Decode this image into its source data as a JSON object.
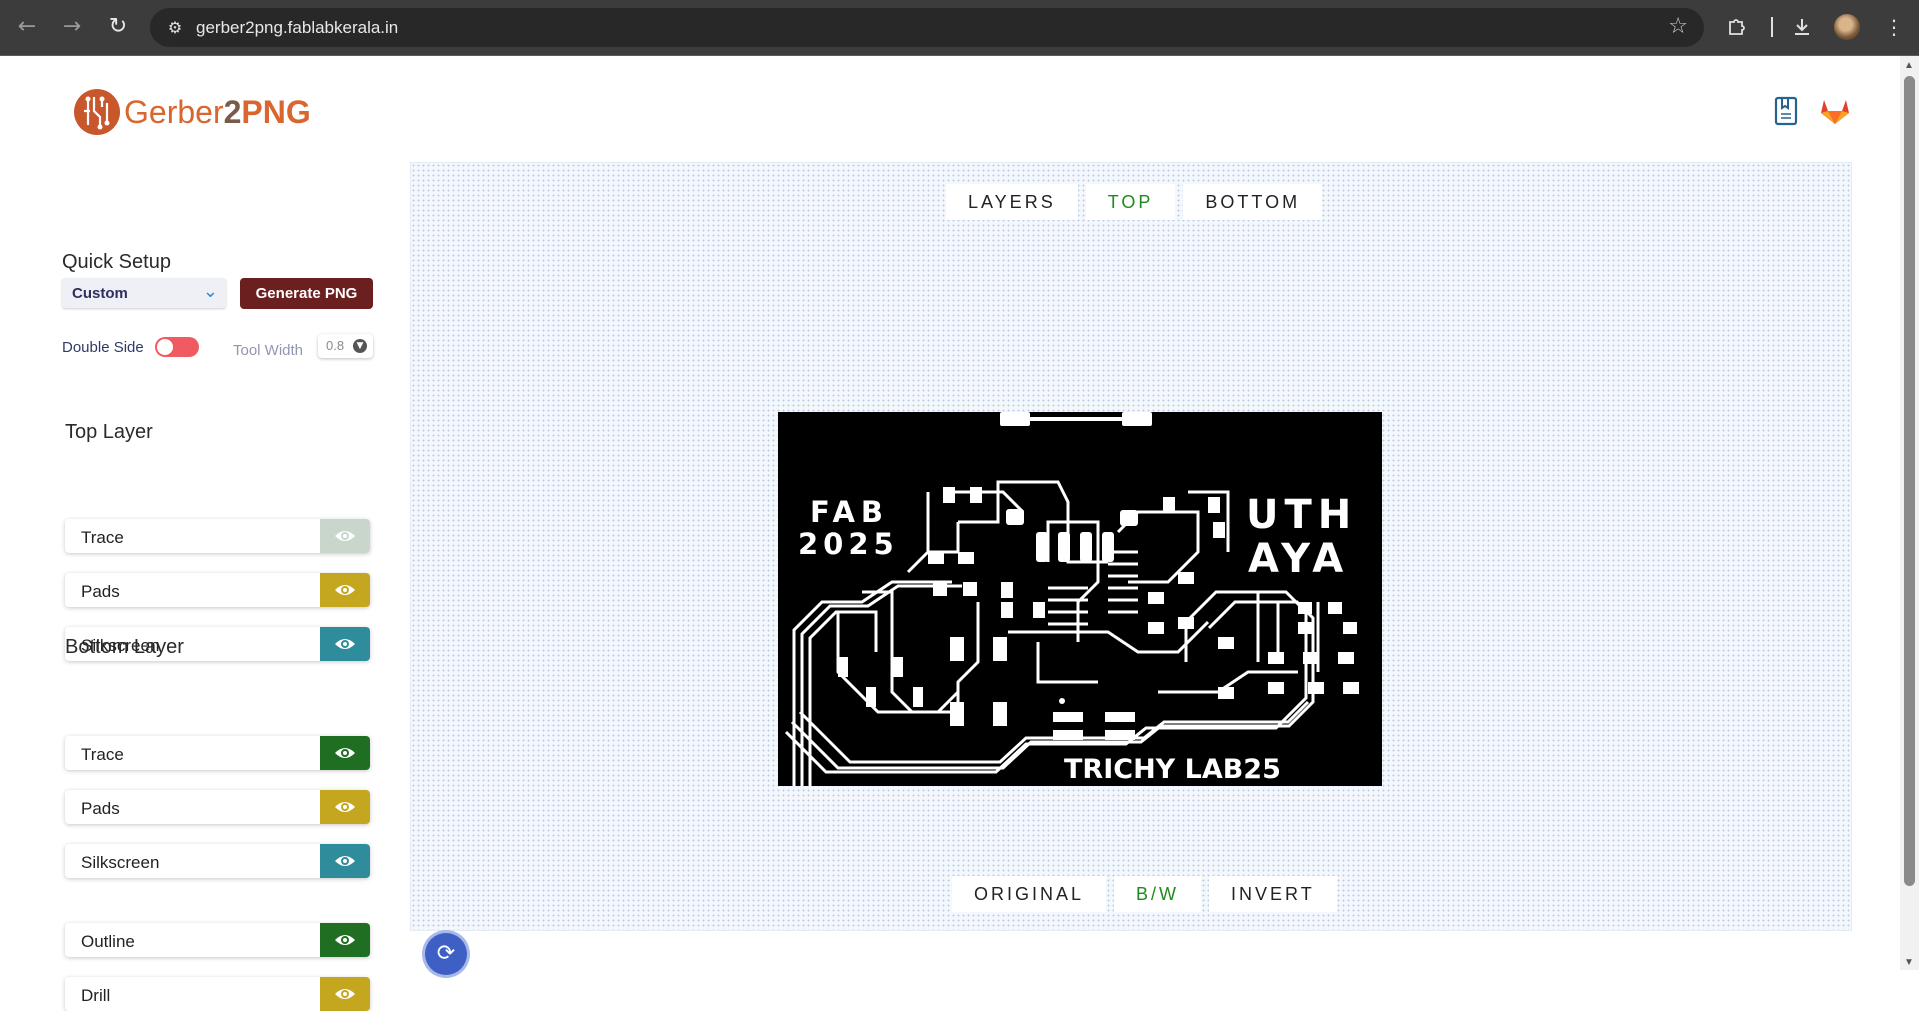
{
  "browser": {
    "url": "gerber2png.fablabkerala.in",
    "icons": [
      "back-arrow-icon",
      "forward-arrow-icon",
      "reload-icon",
      "site-settings-icon",
      "star-icon",
      "extensions-icon",
      "download-icon",
      "profile-avatar",
      "more-menu-icon"
    ]
  },
  "header": {
    "logo_prefix": "Gerber",
    "logo_two": "2",
    "logo_suffix": "PNG",
    "icons": [
      "docs-bookmark-icon",
      "gitlab-icon"
    ]
  },
  "sidebar": {
    "quick_setup_title": "Quick Setup",
    "preset_value": "Custom",
    "generate_label": "Generate PNG",
    "double_side_label": "Double Side",
    "double_side_on": false,
    "tool_width_label": "Tool Width",
    "tool_width_value": "0.8",
    "top_layer_title": "Top Layer",
    "top_layers": [
      {
        "label": "Trace",
        "color": "#c9d6cc",
        "visible": false
      },
      {
        "label": "Pads",
        "color": "#c4a71f",
        "visible": true
      },
      {
        "label": "Silkscreen",
        "color": "#2f8c9a",
        "visible": true
      }
    ],
    "bottom_layer_title": "Bottom Layer",
    "bottom_layers": [
      {
        "label": "Trace",
        "color": "#1f6e22",
        "visible": true
      },
      {
        "label": "Pads",
        "color": "#c4a71f",
        "visible": true
      },
      {
        "label": "Silkscreen",
        "color": "#2f8c9a",
        "visible": true
      }
    ],
    "extra_layers": [
      {
        "label": "Outline",
        "color": "#1f6e22",
        "visible": true
      },
      {
        "label": "Drill",
        "color": "#c4a71f",
        "visible": true
      }
    ]
  },
  "view_tabs": {
    "items": [
      "LAYERS",
      "TOP",
      "BOTTOM"
    ],
    "active": "TOP"
  },
  "render_tabs": {
    "items": [
      "ORIGINAL",
      "B/W",
      "INVERT"
    ],
    "active": "B/W"
  },
  "pcb": {
    "left_text_line1": "FAB",
    "left_text_line2": "2025",
    "right_text_line1": "UTH",
    "right_text_line2": "AYA",
    "bottom_text": "TRICHY LAB25"
  },
  "colors": {
    "accent_green": "#1f8a1f",
    "generate_btn": "#6b1f1f",
    "logo_orange": "#d9652f",
    "refresh_btn": "#3e5fc4"
  }
}
